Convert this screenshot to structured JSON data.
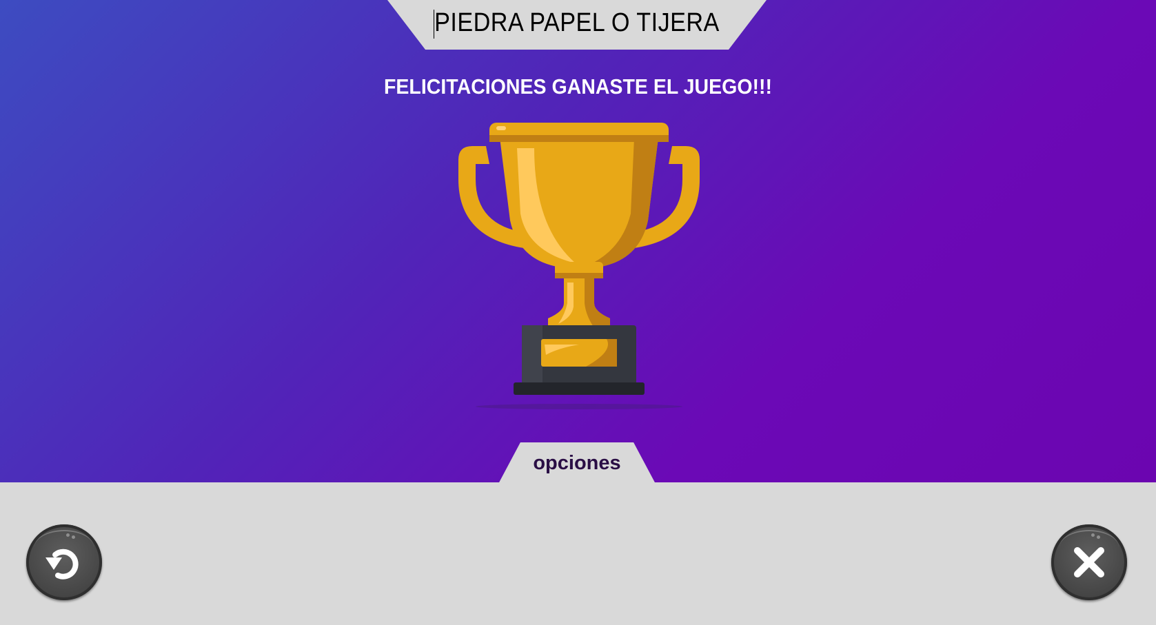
{
  "header": {
    "title": "PIEDRA PAPEL O TIJERA"
  },
  "main": {
    "message": "FELICITACIONES GANASTE EL JUEGO!!!",
    "trophy_icon": "trophy-icon"
  },
  "options": {
    "tab_label": "opciones",
    "restart_icon": "restart-icon",
    "close_icon": "close-icon"
  },
  "colors": {
    "background_start": "#3d4cc1",
    "background_end": "#6b05b0",
    "panel": "#d9d9d9",
    "trophy_gold": "#e8a817",
    "button_dark": "#4a4a4a"
  }
}
